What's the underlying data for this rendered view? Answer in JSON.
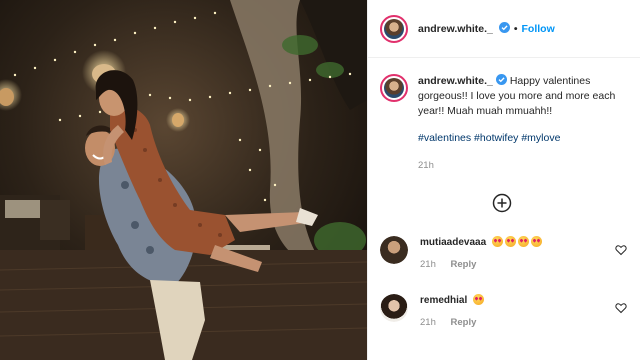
{
  "post_header": {
    "username": "andrew.white._",
    "separator": "•",
    "follow_label": "Follow"
  },
  "caption": {
    "username": "andrew.white._",
    "text": "Happy valentines gorgeous!! I love you more and more each year!! Muah muah mmuahh!!",
    "hashtags": [
      "#valentines",
      "#hotwifey",
      "#mylove"
    ],
    "time": "21h"
  },
  "more_comments_icon": "plus-circle-icon",
  "comments": [
    {
      "username": "mutiaadevaaa",
      "emoji_count": 4,
      "time": "21h",
      "reply_label": "Reply"
    },
    {
      "username": "remedhial",
      "emoji_count": 1,
      "time": "21h",
      "reply_label": "Reply"
    }
  ],
  "colors": {
    "follow_blue": "#0095f6",
    "hashtag": "#00376b",
    "muted": "#8e8e8e",
    "story_ring": "#e1306c",
    "verified_blue": "#3897f0"
  }
}
